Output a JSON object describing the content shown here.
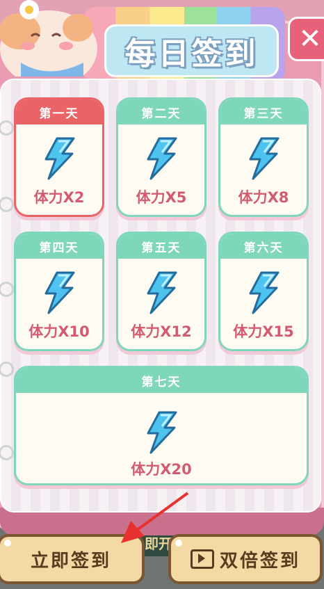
{
  "title": "每日签到",
  "days": [
    {
      "header": "第一天",
      "reward": "体力X2",
      "state": "current"
    },
    {
      "header": "第二天",
      "reward": "体力X5",
      "state": "locked"
    },
    {
      "header": "第三天",
      "reward": "体力X8",
      "state": "locked"
    },
    {
      "header": "第四天",
      "reward": "体力X10",
      "state": "locked"
    },
    {
      "header": "第五天",
      "reward": "体力X12",
      "state": "locked"
    },
    {
      "header": "第六天",
      "reward": "体力X15",
      "state": "locked"
    },
    {
      "header": "第七天",
      "reward": "体力X20",
      "state": "locked"
    }
  ],
  "buttons": {
    "sign_in": "立即签到",
    "double_sign_in": "双倍签到"
  },
  "background_text": "即开",
  "icons": {
    "reward_icon": "lightning-bolt-icon",
    "close_icon": "close-icon",
    "video_icon": "video-ad-icon",
    "pointer": "red-arrow-pointer"
  },
  "colors": {
    "active_header": "#ea6366",
    "normal_header": "#7ed7bb",
    "reward_text": "#d35b71",
    "button_bg": "#f3d9a4"
  }
}
